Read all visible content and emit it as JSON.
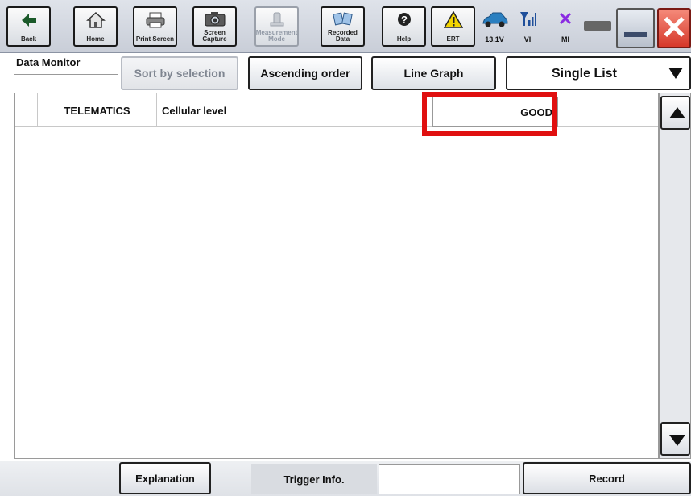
{
  "toolbar": {
    "buttons": [
      {
        "label": "Back",
        "icon": "back-arrow-icon"
      },
      {
        "label": "Home",
        "icon": "home-icon"
      },
      {
        "label": "Print Screen",
        "icon": "printer-icon"
      },
      {
        "label": "Screen\nCapture",
        "icon": "camera-icon"
      },
      {
        "label": "Measurement\nMode",
        "icon": "measurement-icon",
        "disabled": true
      },
      {
        "label": "Recorded\nData",
        "icon": "recorded-data-icon"
      },
      {
        "label": "Help",
        "icon": "help-icon"
      },
      {
        "label": "ERT",
        "icon": "warning-icon"
      }
    ],
    "status": {
      "voltage": "13.1V",
      "vi": "VI",
      "mi": "MI"
    },
    "colors": {
      "warning": "#f2d400",
      "car": "#2a7fc0",
      "signal": "#1f4f9a",
      "mi_x": "#8a2be2"
    }
  },
  "header": {
    "title": "Data Monitor",
    "sort_by_selection": "Sort by selection",
    "ascending_order": "Ascending order",
    "line_graph": "Line Graph",
    "view_mode": "Single List"
  },
  "data_rows": [
    {
      "system": "TELEMATICS",
      "item": "Cellular level",
      "value": "GOOD"
    }
  ],
  "highlight_color": "#e01010",
  "footer": {
    "explanation": "Explanation",
    "trigger_info": "Trigger Info.",
    "record": "Record"
  }
}
